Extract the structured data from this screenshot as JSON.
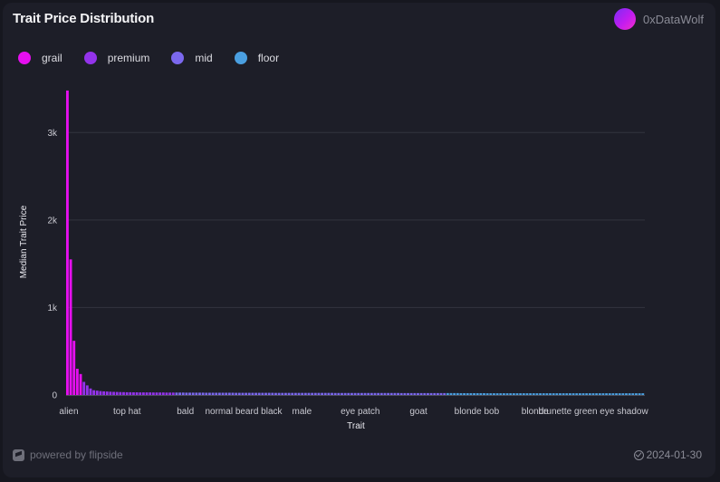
{
  "header": {
    "title": "Trait Price Distribution",
    "author": "0xDataWolf"
  },
  "legend": [
    {
      "label": "grail",
      "color": "#e60ff0"
    },
    {
      "label": "premium",
      "color": "#9333ea"
    },
    {
      "label": "mid",
      "color": "#7b68ee"
    },
    {
      "label": "floor",
      "color": "#4a9fe0"
    }
  ],
  "footer": {
    "powered_by": "powered by flipside",
    "date": "2024-01-30"
  },
  "chart_data": {
    "type": "bar",
    "xlabel": "Trait",
    "ylabel": "Median Trait Price",
    "ylim": [
      0,
      3500
    ],
    "yticks": [
      0,
      1000,
      2000,
      3000
    ],
    "ytick_labels": [
      "0",
      "1k",
      "2k",
      "3k"
    ],
    "grid": true,
    "legend_position": "top-left",
    "x_tick_labels": [
      "alien",
      "top hat",
      "bald",
      "normal beard black",
      "male",
      "eye patch",
      "goat",
      "blonde bob",
      "blonde",
      "brunette green eye shadow"
    ],
    "series": [
      {
        "name": "grail",
        "color": "#e60ff0",
        "values": [
          3480,
          1550,
          620,
          300,
          240
        ]
      },
      {
        "name": "premium",
        "color": "#9333ea",
        "values": [
          150,
          110,
          75,
          55,
          50,
          45,
          42,
          40,
          38,
          36,
          35,
          34,
          33,
          32,
          32,
          31,
          31,
          30,
          30,
          30,
          30,
          29,
          29,
          29,
          29,
          28,
          28,
          28
        ]
      },
      {
        "name": "mid",
        "color": "#7b68ee",
        "values": [
          28,
          28,
          28,
          27,
          27,
          27,
          27,
          27,
          27,
          26,
          26,
          26,
          26,
          26,
          26,
          26,
          26,
          26,
          25,
          25,
          25,
          25,
          25,
          25,
          25,
          25,
          25,
          25,
          25,
          25,
          24,
          24,
          24,
          24,
          24,
          24,
          24,
          24,
          24,
          24,
          24,
          24,
          24,
          24,
          24,
          24,
          24,
          24,
          23,
          23,
          23,
          23,
          23,
          23,
          23,
          23,
          23,
          23,
          23,
          23,
          23,
          23,
          23,
          23,
          23,
          23,
          23,
          23,
          22,
          22,
          22,
          22,
          22,
          22,
          22,
          22,
          22,
          22,
          22,
          22,
          22,
          22
        ]
      },
      {
        "name": "floor",
        "color": "#4a9fe0",
        "values": [
          22,
          22,
          22,
          22,
          21,
          21,
          21,
          21,
          21,
          21,
          21,
          21,
          20,
          20,
          20,
          20,
          20,
          20,
          20,
          20,
          20,
          20,
          20,
          20,
          20,
          20,
          20,
          20,
          20,
          20,
          20,
          20,
          20,
          20,
          20,
          20,
          20,
          20,
          20,
          20,
          20,
          20,
          20,
          20,
          20,
          20,
          20,
          20,
          20,
          20,
          20,
          20,
          20,
          20,
          20,
          20,
          20,
          20,
          20,
          20
        ]
      }
    ]
  }
}
